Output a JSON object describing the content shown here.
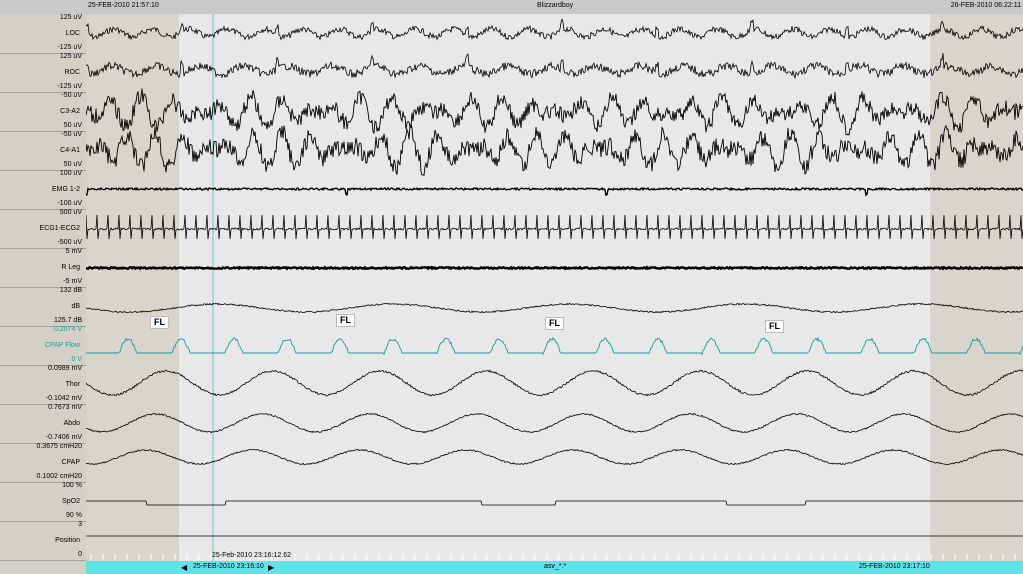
{
  "header": {
    "start_time": "25-FEB-2010 21:57:10",
    "title": "Blizzardboy",
    "end_time": "26-FEB-2010 06:22:11"
  },
  "channels": [
    {
      "name": "LOC",
      "top_scale": "125 uV",
      "bottom_scale": "-125 uV"
    },
    {
      "name": "ROC",
      "top_scale": "125 uV",
      "bottom_scale": "-125 uV"
    },
    {
      "name": "C3-A2",
      "top_scale": "-50 uV",
      "bottom_scale": "50 uV"
    },
    {
      "name": "C4-A1",
      "top_scale": "-50 uV",
      "bottom_scale": "50 uV"
    },
    {
      "name": "EMG 1-2",
      "top_scale": "100 uV",
      "bottom_scale": "-100 uV"
    },
    {
      "name": "ECG1-ECG2",
      "top_scale": "500 uV",
      "bottom_scale": "-500 uV"
    },
    {
      "name": "R Leg",
      "top_scale": "5 mV",
      "bottom_scale": "-5 mV"
    },
    {
      "name": "dB",
      "top_scale": "132 dB",
      "bottom_scale": "125.7 dB"
    },
    {
      "name": "CPAP Flow",
      "top_scale": "0.2074 V",
      "bottom_scale": "0 V"
    },
    {
      "name": "Thor",
      "top_scale": "0.0989 mV",
      "bottom_scale": "-0.1042 mV"
    },
    {
      "name": "Abdo",
      "top_scale": "0.7673 mV",
      "bottom_scale": "-0.7406 mV"
    },
    {
      "name": "CPAP",
      "top_scale": "0.3675 cmH20",
      "bottom_scale": "0.1002 cmH20"
    },
    {
      "name": "SpO2",
      "top_scale": "100 %",
      "bottom_scale": "90 %"
    },
    {
      "name": "Position",
      "top_scale": "3",
      "bottom_scale": "0"
    }
  ],
  "annotations": [
    "FL",
    "FL",
    "FL",
    "FL"
  ],
  "cursor_time": "25-Feb-2010 23:16:12.62",
  "footer": {
    "prev_arrow": "◀",
    "window_start": "25-FEB-2010 23:16:10",
    "next_arrow": "▶",
    "center_label": "asv_*.*",
    "window_end": "25-FEB-2010 23:17:10"
  },
  "colors": {
    "background": "#ffffff",
    "panel": "#d4d0c8",
    "shaded_region": "#d9d4cc",
    "selected_region": "#e8e8e8",
    "flow_trace": "#1a9c9c",
    "trace": "#000000",
    "cursor": "#5fc8d0",
    "timebar": "#5fe3e8"
  }
}
